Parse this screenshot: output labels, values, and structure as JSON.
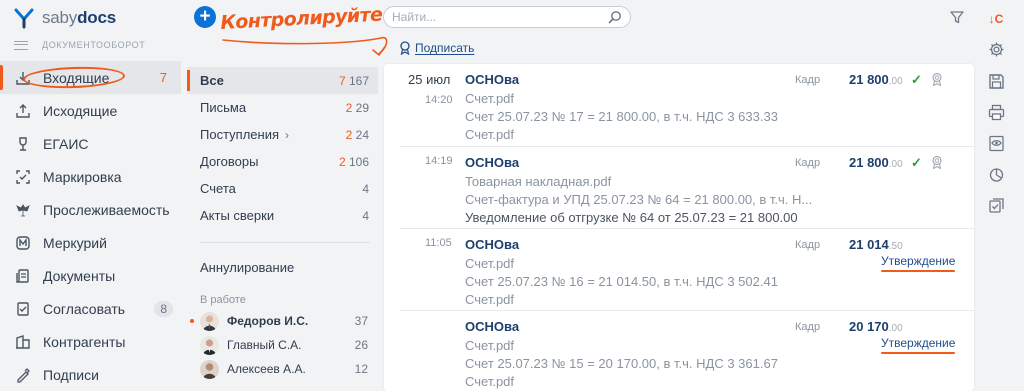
{
  "brand": {
    "light": "sabу",
    "bold": "docs"
  },
  "nav": {
    "section_title": "ДОКУМЕНТООБОРОТ",
    "items": [
      {
        "label": "Входящие",
        "count": "7",
        "icon": "inbox-icon"
      },
      {
        "label": "Исходящие",
        "icon": "outbox-icon"
      },
      {
        "label": "ЕГАИС",
        "icon": "wine-glass-icon"
      },
      {
        "label": "Маркировка",
        "icon": "marking-icon"
      },
      {
        "label": "Прослеживаемость",
        "icon": "eagle-icon"
      },
      {
        "label": "Меркурий",
        "icon": "mercury-icon"
      },
      {
        "label": "Документы",
        "icon": "documents-icon"
      },
      {
        "label": "Согласовать",
        "count": "8",
        "icon": "approve-icon"
      },
      {
        "label": "Контрагенты",
        "icon": "counterparty-icon"
      },
      {
        "label": "Подписи",
        "icon": "signature-icon"
      }
    ]
  },
  "annotation": "Контролируйте",
  "search": {
    "placeholder": "Найти..."
  },
  "sign_action": "Подписать",
  "folders": [
    {
      "label": "Все",
      "red": "7",
      "total": "167"
    },
    {
      "label": "Письма",
      "red": "2",
      "total": "29"
    },
    {
      "label": "Поступления",
      "red": "2",
      "total": "24",
      "chevron": "›"
    },
    {
      "label": "Договоры",
      "red": "2",
      "total": "106"
    },
    {
      "label": "Счета",
      "red": "",
      "total": "4"
    },
    {
      "label": "Акты сверки",
      "red": "",
      "total": "4"
    }
  ],
  "annulment": "Аннулирование",
  "in_work": {
    "title": "В работе",
    "people": [
      {
        "name": "Федоров И.С.",
        "count": "37"
      },
      {
        "name": "Главный С.А.",
        "count": "26"
      },
      {
        "name": "Алексеев А.А.",
        "count": "12"
      }
    ]
  },
  "documents": [
    {
      "date": "25 июл",
      "time": "14:20",
      "org": "ОСНОва",
      "source": "Кадр",
      "sum_int": "21 800",
      "sum_frac": ".00",
      "check": "✓",
      "lines": [
        "Счет.pdf",
        "Счет 25.07.23 № 17 = 21 800.00, в т.ч. НДС 3 633.33",
        "Счет.pdf"
      ]
    },
    {
      "date": "",
      "time": "14:19",
      "org": "ОСНОва",
      "source": "Кадр",
      "sum_int": "21 800",
      "sum_frac": ".00",
      "check": "✓",
      "lines": [
        "Товарная накладная.pdf",
        "Счет-фактура и УПД 25.07.23 № 64 = 21 800.00, в т.ч. Н...",
        "Уведомление об отгрузке № 64 от 25.07.23 = 21 800.00"
      ]
    },
    {
      "date": "",
      "time": "11:05",
      "org": "ОСНОва",
      "source": "Кадр",
      "sum_int": "21 014",
      "sum_frac": ".50",
      "status": "Утверждение",
      "lines": [
        "Счет.pdf",
        "Счет 25.07.23 № 16 = 21 014.50, в т.ч. НДС 3 502.41",
        "Счет.pdf"
      ]
    },
    {
      "date": "",
      "time": "",
      "org": "ОСНОва",
      "source": "Кадр",
      "sum_int": "20 170",
      "sum_frac": ".00",
      "status": "Утверждение",
      "lines": [
        "Счет.pdf",
        "Счет 25.07.23 № 15 = 20 170.00, в т.ч. НДС 3 361.67",
        "Счет.pdf"
      ]
    }
  ],
  "toolbar": {
    "sort_label": "↓С",
    "icons": [
      "filter-icon",
      "settings-icon",
      "save-icon",
      "print-icon",
      "preview-icon",
      "chart-icon",
      "checklist-icon"
    ]
  },
  "colors": {
    "accent": "#f05a1a",
    "brand_blue": "#0c73d6",
    "link": "#1e4e8c",
    "ok": "#2e9d3b"
  }
}
